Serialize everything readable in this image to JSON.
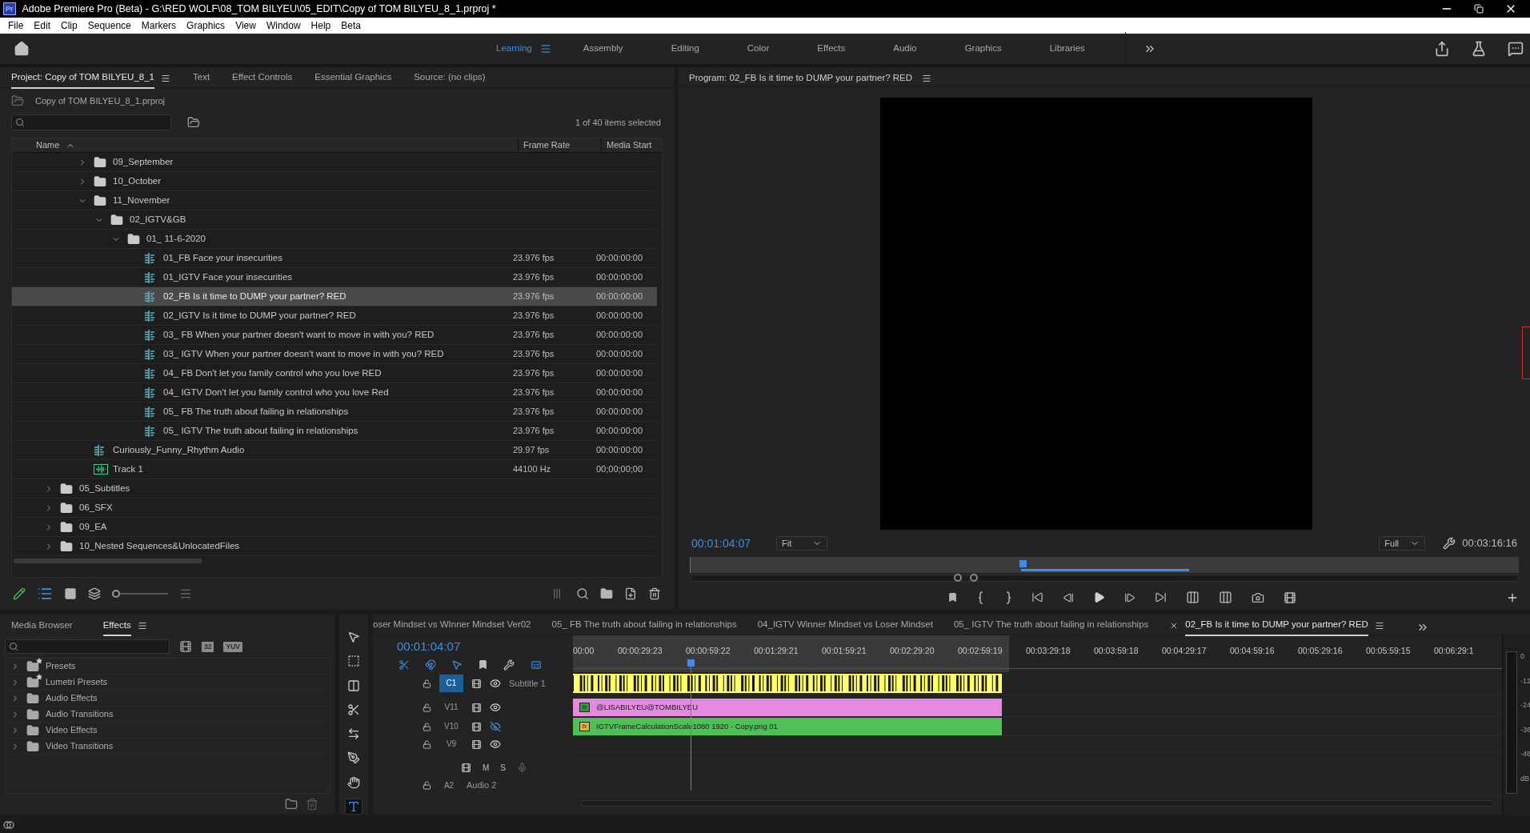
{
  "window": {
    "app_icon": "Pr",
    "title": "Adobe Premiere Pro (Beta) - G:\\RED WOLF\\08_TOM BILYEU\\05_EDIT\\Copy of TOM BILYEU_8_1.prproj *"
  },
  "menu": [
    "File",
    "Edit",
    "Clip",
    "Sequence",
    "Markers",
    "Graphics",
    "View",
    "Window",
    "Help",
    "Beta"
  ],
  "workspaces": [
    {
      "label": "Learning",
      "selected": true
    },
    {
      "label": "Assembly",
      "selected": false
    },
    {
      "label": "Editing",
      "selected": false
    },
    {
      "label": "Color",
      "selected": false
    },
    {
      "label": "Effects",
      "selected": false
    },
    {
      "label": "Audio",
      "selected": false
    },
    {
      "label": "Graphics",
      "selected": false
    },
    {
      "label": "Libraries",
      "selected": false
    }
  ],
  "project_panel": {
    "tabs": [
      {
        "label": "Project: Copy of TOM BILYEU_8_1",
        "selected": true
      },
      {
        "label": "Text",
        "selected": false
      },
      {
        "label": "Effect Controls",
        "selected": false
      },
      {
        "label": "Essential Graphics",
        "selected": false
      },
      {
        "label": "Source: (no clips)",
        "selected": false
      }
    ],
    "path": "Copy of TOM BILYEU_8_1.prproj",
    "selection_count": "1 of 40 items selected",
    "columns": [
      "Name",
      "Frame Rate",
      "Media Start"
    ],
    "view_zoom": {
      "level": 0
    },
    "tree": [
      {
        "children": [
          {
            "children": [
              {
                "kind": "folder",
                "label": "09_September",
                "expanded": false,
                "selected": false
              },
              {
                "kind": "folder",
                "label": "10_October",
                "expanded": false,
                "selected": false
              },
              {
                "kind": "folder",
                "label": "11_November",
                "expanded": true,
                "selected": false,
                "children": [
                  {
                    "kind": "folder",
                    "label": "02_IGTV&GB",
                    "expanded": true,
                    "selected": false,
                    "children": [
                      {
                        "kind": "folder",
                        "label": "01_ 11-6-2020",
                        "expanded": true,
                        "selected": false,
                        "children": [
                          {
                            "kind": "sequence",
                            "label": "01_FB Face your insecurities",
                            "frame_rate": "23.976 fps",
                            "media_start": "00:00:00:00",
                            "selected": false
                          },
                          {
                            "kind": "sequence",
                            "label": "01_IGTV Face your insecurities",
                            "frame_rate": "23.976 fps",
                            "media_start": "00:00:00:00",
                            "selected": false
                          },
                          {
                            "kind": "sequence",
                            "label": "02_FB Is it time to DUMP your partner? RED",
                            "frame_rate": "23.976 fps",
                            "media_start": "00:00:00:00",
                            "selected": true
                          },
                          {
                            "kind": "sequence",
                            "label": "02_IGTV Is it time to DUMP your partner? RED",
                            "frame_rate": "23.976 fps",
                            "media_start": "00:00:00:00",
                            "selected": false
                          },
                          {
                            "kind": "sequence",
                            "label": "03_ FB When your partner doesn't want to move in with you? RED",
                            "frame_rate": "23.976 fps",
                            "media_start": "00:00:00:00",
                            "selected": false
                          },
                          {
                            "kind": "sequence",
                            "label": "03_ IGTV When your partner doesn't want to move in with you? RED",
                            "frame_rate": "23.976 fps",
                            "media_start": "00:00:00:00",
                            "selected": false
                          },
                          {
                            "kind": "sequence",
                            "label": "04_ FB Don't let you family control who you love RED",
                            "frame_rate": "23.976 fps",
                            "media_start": "00:00:00:00",
                            "selected": false
                          },
                          {
                            "kind": "sequence",
                            "label": "04_ IGTV Don't let you family control who you love Red",
                            "frame_rate": "23.976 fps",
                            "media_start": "00:00:00:00",
                            "selected": false
                          },
                          {
                            "kind": "sequence",
                            "label": "05_ FB The truth about failing in relationships",
                            "frame_rate": "23.976 fps",
                            "media_start": "00:00:00:00",
                            "selected": false
                          },
                          {
                            "kind": "sequence",
                            "label": "05_ IGTV The truth about failing in relationships",
                            "frame_rate": "23.976 fps",
                            "media_start": "00:00:00:00",
                            "selected": false
                          }
                        ]
                      }
                    ]
                  }
                ]
              },
              {
                "kind": "sequence",
                "label": "Curiously_Funny_Rhythm Audio",
                "frame_rate": "29.97 fps",
                "media_start": "00:00:00:00",
                "selected": false
              },
              {
                "kind": "audio",
                "label": "Track 1",
                "frame_rate": "44100 Hz",
                "media_start": "00;00;00;00",
                "selected": false
              }
            ]
          }
        ]
      },
      {
        "kind": "folder",
        "label": "05_Subtitles",
        "expanded": false,
        "selected": false
      },
      {
        "kind": "folder",
        "label": "06_SFX",
        "expanded": false,
        "selected": false
      },
      {
        "kind": "folder",
        "label": "09_EA",
        "expanded": false,
        "selected": false
      },
      {
        "kind": "folder",
        "label": "10_Nested Sequences&UnlocatedFiles",
        "expanded": false,
        "selected": false
      }
    ]
  },
  "program_monitor": {
    "title": "Program: 02_FB Is it time to DUMP your partner? RED",
    "timecode": "00:01:04:07",
    "zoom": "Fit",
    "resolution": "Full",
    "duration": "00:03:16:16"
  },
  "effects_panel": {
    "tabs": [
      {
        "label": "Media Browser",
        "selected": false
      },
      {
        "label": "Effects",
        "selected": true
      }
    ],
    "badges": [
      "32",
      "YUV"
    ],
    "items": [
      {
        "kind": "preset",
        "label": "Presets"
      },
      {
        "kind": "preset",
        "label": "Lumetri Presets"
      },
      {
        "kind": "folder",
        "label": "Audio Effects"
      },
      {
        "kind": "folder",
        "label": "Audio Transitions"
      },
      {
        "kind": "folder",
        "label": "Video Effects"
      },
      {
        "kind": "folder",
        "label": "Video Transitions"
      }
    ]
  },
  "tools": [
    {
      "kind": "selection",
      "selected": false
    },
    {
      "kind": "track-select",
      "selected": false
    },
    {
      "kind": "ripple",
      "selected": false
    },
    {
      "kind": "razor",
      "selected": false
    },
    {
      "kind": "slip",
      "selected": false
    },
    {
      "kind": "pen",
      "selected": false
    },
    {
      "kind": "hand",
      "selected": false
    },
    {
      "kind": "type",
      "selected": true
    }
  ],
  "timeline": {
    "tabs": [
      {
        "label": "oser Mindset vs WInner Mindset Ver02",
        "selected": false
      },
      {
        "label": "05_ FB The truth about failing in relationships",
        "selected": false
      },
      {
        "label": "04_IGTV Winner Mindset vs Loser Mindset",
        "selected": false
      },
      {
        "label": "05_ IGTV The truth about failing in relationships",
        "selected": false
      },
      {
        "label": "02_FB Is it time to DUMP your partner? RED",
        "selected": true
      }
    ],
    "timecode": "00:01:04:07",
    "ruler": [
      "00:00",
      "00:00:29:23",
      "00:00:59:22",
      "00:01:29:21",
      "00:01:59:21",
      "00:02:29:20",
      "00:02:59:19",
      "00:03:29:18",
      "00:03:59:18",
      "00:04:29:17",
      "00:04:59:16",
      "00:05:29:16",
      "00:05:59:15",
      "00:06:29:1"
    ],
    "tracks": [
      {
        "kind": "caption",
        "label": "C1",
        "targeted": true,
        "visible": true,
        "name": "Subtitle 1",
        "clip": {
          "kind": "caption",
          "color": "#ffff66"
        }
      },
      {
        "kind": "video",
        "label": "V11",
        "targeted": false,
        "visible": true,
        "clip": {
          "kind": "graphic",
          "color": "#e58ae0",
          "label": "@LISABILYEU@TOMBILYEU",
          "fx_badge": {
            "label": "fx",
            "color": "#2e9b3a"
          }
        }
      },
      {
        "kind": "video",
        "label": "V10",
        "targeted": false,
        "visible": false,
        "clip": {
          "kind": "graphic",
          "color": "#4fbf57",
          "label": "IGTVFrameCalculationScale1080 1920 - Copy.png 01",
          "fx_badge": {
            "label": "fx",
            "color": "#e0b431"
          }
        }
      },
      {
        "kind": "video",
        "label": "V9",
        "targeted": false,
        "visible": true
      },
      {
        "kind": "audio",
        "label": "A2",
        "targeted": false,
        "name": "Audio 2",
        "mute": "M",
        "solo": "S"
      }
    ]
  },
  "audio_meter": {
    "scale": [
      "0",
      "-12",
      "-24",
      "-36",
      "-48",
      "dB"
    ]
  }
}
